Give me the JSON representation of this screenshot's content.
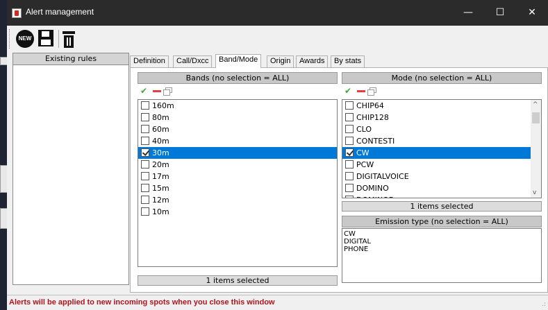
{
  "window": {
    "title": "Alert management",
    "minimize_glyph": "—",
    "maximize_glyph": "☐",
    "close_glyph": "✕"
  },
  "toolbar": {
    "new_label": "NEW",
    "icons": [
      "new-icon",
      "save-icon",
      "delete-icon"
    ]
  },
  "rules_panel": {
    "header": "Existing rules"
  },
  "tabs": [
    {
      "label": "Definition"
    },
    {
      "label": "Call/Dxcc"
    },
    {
      "label": "Band/Mode"
    },
    {
      "label": "Origin"
    },
    {
      "label": "Awards"
    },
    {
      "label": "By stats"
    }
  ],
  "active_tab": "Band/Mode",
  "bands": {
    "header": "Bands (no selection = ALL)",
    "items": [
      {
        "label": "160m",
        "checked": false
      },
      {
        "label": "80m",
        "checked": false
      },
      {
        "label": "60m",
        "checked": false
      },
      {
        "label": "40m",
        "checked": false
      },
      {
        "label": "30m",
        "checked": true
      },
      {
        "label": "20m",
        "checked": false
      },
      {
        "label": "17m",
        "checked": false
      },
      {
        "label": "15m",
        "checked": false
      },
      {
        "label": "12m",
        "checked": false
      },
      {
        "label": "10m",
        "checked": false
      }
    ],
    "status": "1 items selected"
  },
  "modes": {
    "header": "Mode (no selection = ALL)",
    "items": [
      {
        "label": "CHIP64",
        "checked": false
      },
      {
        "label": "CHIP128",
        "checked": false
      },
      {
        "label": "CLO",
        "checked": false
      },
      {
        "label": "CONTESTI",
        "checked": false
      },
      {
        "label": "CW",
        "checked": true
      },
      {
        "label": "PCW",
        "checked": false
      },
      {
        "label": "DIGITALVOICE",
        "checked": false
      },
      {
        "label": "DOMINO",
        "checked": false
      },
      {
        "label": "DOMINOF",
        "checked": false
      }
    ],
    "status": "1 items selected"
  },
  "emission": {
    "header": "Emission type (no selection = ALL)",
    "items": [
      "CW",
      "DIGITAL",
      "PHONE"
    ]
  },
  "status_message": "Alerts will be applied to new incoming spots when you close this window",
  "colors": {
    "selection": "#0078d7",
    "status_text": "#b0141e",
    "check_icon": "#3aa83a",
    "minus_icon": "#e04040"
  }
}
